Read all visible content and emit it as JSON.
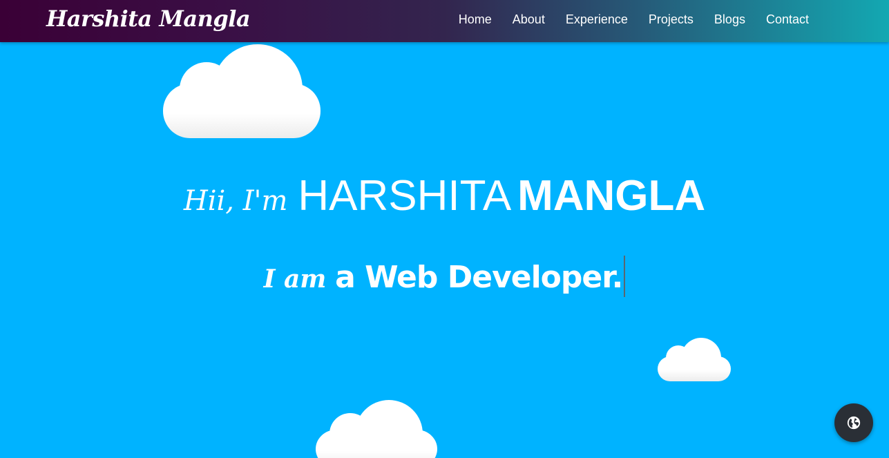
{
  "nav": {
    "brand": "Harshita Mangla",
    "links": [
      "Home",
      "About",
      "Experience",
      "Projects",
      "Blogs",
      "Contact"
    ]
  },
  "hero": {
    "greeting": "Hii, I'm",
    "first_name": "HARSHITA",
    "last_name": "MANGLA",
    "prefix": "I am",
    "role": "a Web Developer."
  },
  "floating_button": {
    "icon": "globe-icon"
  },
  "colors": {
    "background": "#00b3ff",
    "nav_gradient_start": "#3a0036",
    "nav_gradient_end": "#13a8b2",
    "text": "#ffffff",
    "fab": "#2a2f36"
  }
}
